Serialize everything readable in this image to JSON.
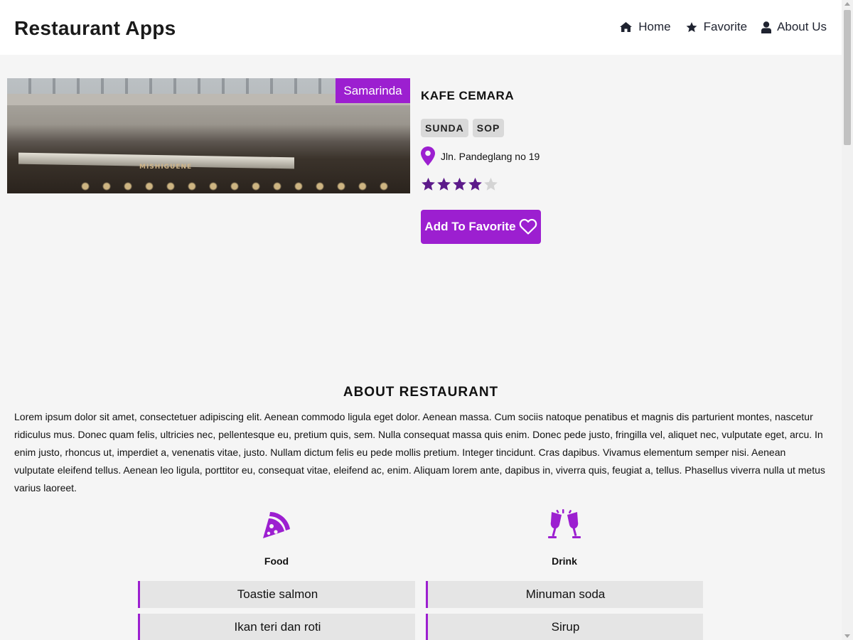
{
  "app": {
    "title": "Restaurant Apps",
    "accent_color": "#9c1fd0",
    "star_color": "#5c1a8a"
  },
  "nav": {
    "items": [
      {
        "label": "Home",
        "icon": "home-icon"
      },
      {
        "label": "Favorite",
        "icon": "star-icon"
      },
      {
        "label": "About Us",
        "icon": "user-icon"
      }
    ]
  },
  "restaurant": {
    "city": "Samarinda",
    "name": "KAFE CEMARA",
    "categories": [
      "SUNDA",
      "SOP"
    ],
    "address": "Jln. Pandeglang no 19",
    "rating": 4,
    "rating_max": 5,
    "favorite_button": {
      "label": "Add To Favorite",
      "icon": "heart-icon"
    }
  },
  "about": {
    "title": "ABOUT RESTAURANT",
    "text": "Lorem ipsum dolor sit amet, consectetuer adipiscing elit. Aenean commodo ligula eget dolor. Aenean massa. Cum sociis natoque penatibus et magnis dis parturient montes, nascetur ridiculus mus. Donec quam felis, ultricies nec, pellentesque eu, pretium quis, sem. Nulla consequat massa quis enim. Donec pede justo, fringilla vel, aliquet nec, vulputate eget, arcu. In enim justo, rhoncus ut, imperdiet a, venenatis vitae, justo. Nullam dictum felis eu pede mollis pretium. Integer tincidunt. Cras dapibus. Vivamus elementum semper nisi. Aenean vulputate eleifend tellus. Aenean leo ligula, porttitor eu, consequat vitae, eleifend ac, enim. Aliquam lorem ante, dapibus in, viverra quis, feugiat a, tellus. Phasellus viverra nulla ut metus varius laoreet."
  },
  "menus": {
    "food": {
      "heading": "Food",
      "icon": "pizza-icon",
      "items": [
        "Toastie salmon",
        "Ikan teri dan roti"
      ]
    },
    "drink": {
      "heading": "Drink",
      "icon": "glasses-cheers-icon",
      "items": [
        "Minuman soda",
        "Sirup"
      ]
    }
  }
}
